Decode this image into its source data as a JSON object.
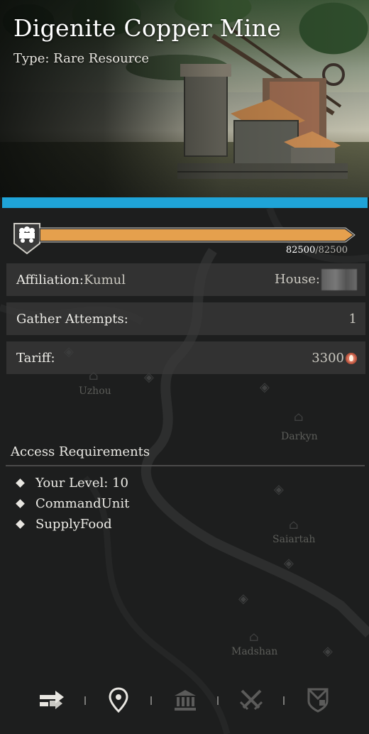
{
  "header": {
    "title": "Digenite Copper Mine",
    "subtitle": "Type: Rare Resource"
  },
  "progress": {
    "current": "82500",
    "max": "82500",
    "fill_fraction": 1.0,
    "icon": "mine-cart-icon"
  },
  "info_rows": {
    "affiliation_label": "Affiliation:",
    "affiliation_value": "Kumul",
    "house_label": "House:",
    "gather_label": "Gather Attempts:",
    "gather_value": "1",
    "tariff_label": "Tariff:",
    "tariff_value": "3300",
    "tariff_icon": "currency-coin-icon"
  },
  "requirements": {
    "title": "Access Requirements",
    "items": [
      "Your Level: 10",
      "CommandUnit",
      "SupplyFood"
    ]
  },
  "map": {
    "places": [
      "Uzhou",
      "Darkyn",
      "Saiartah",
      "Madshan"
    ]
  },
  "bottom_nav": {
    "items": [
      "arrows-icon",
      "location-pin-icon",
      "bank-icon",
      "crossed-swords-icon",
      "shield-banner-icon"
    ]
  },
  "colors": {
    "accent": "#1fa4d8",
    "progress_fill": "#e5a04d",
    "row_bg": "#3a3a3a",
    "background": "#1d1e1e"
  }
}
